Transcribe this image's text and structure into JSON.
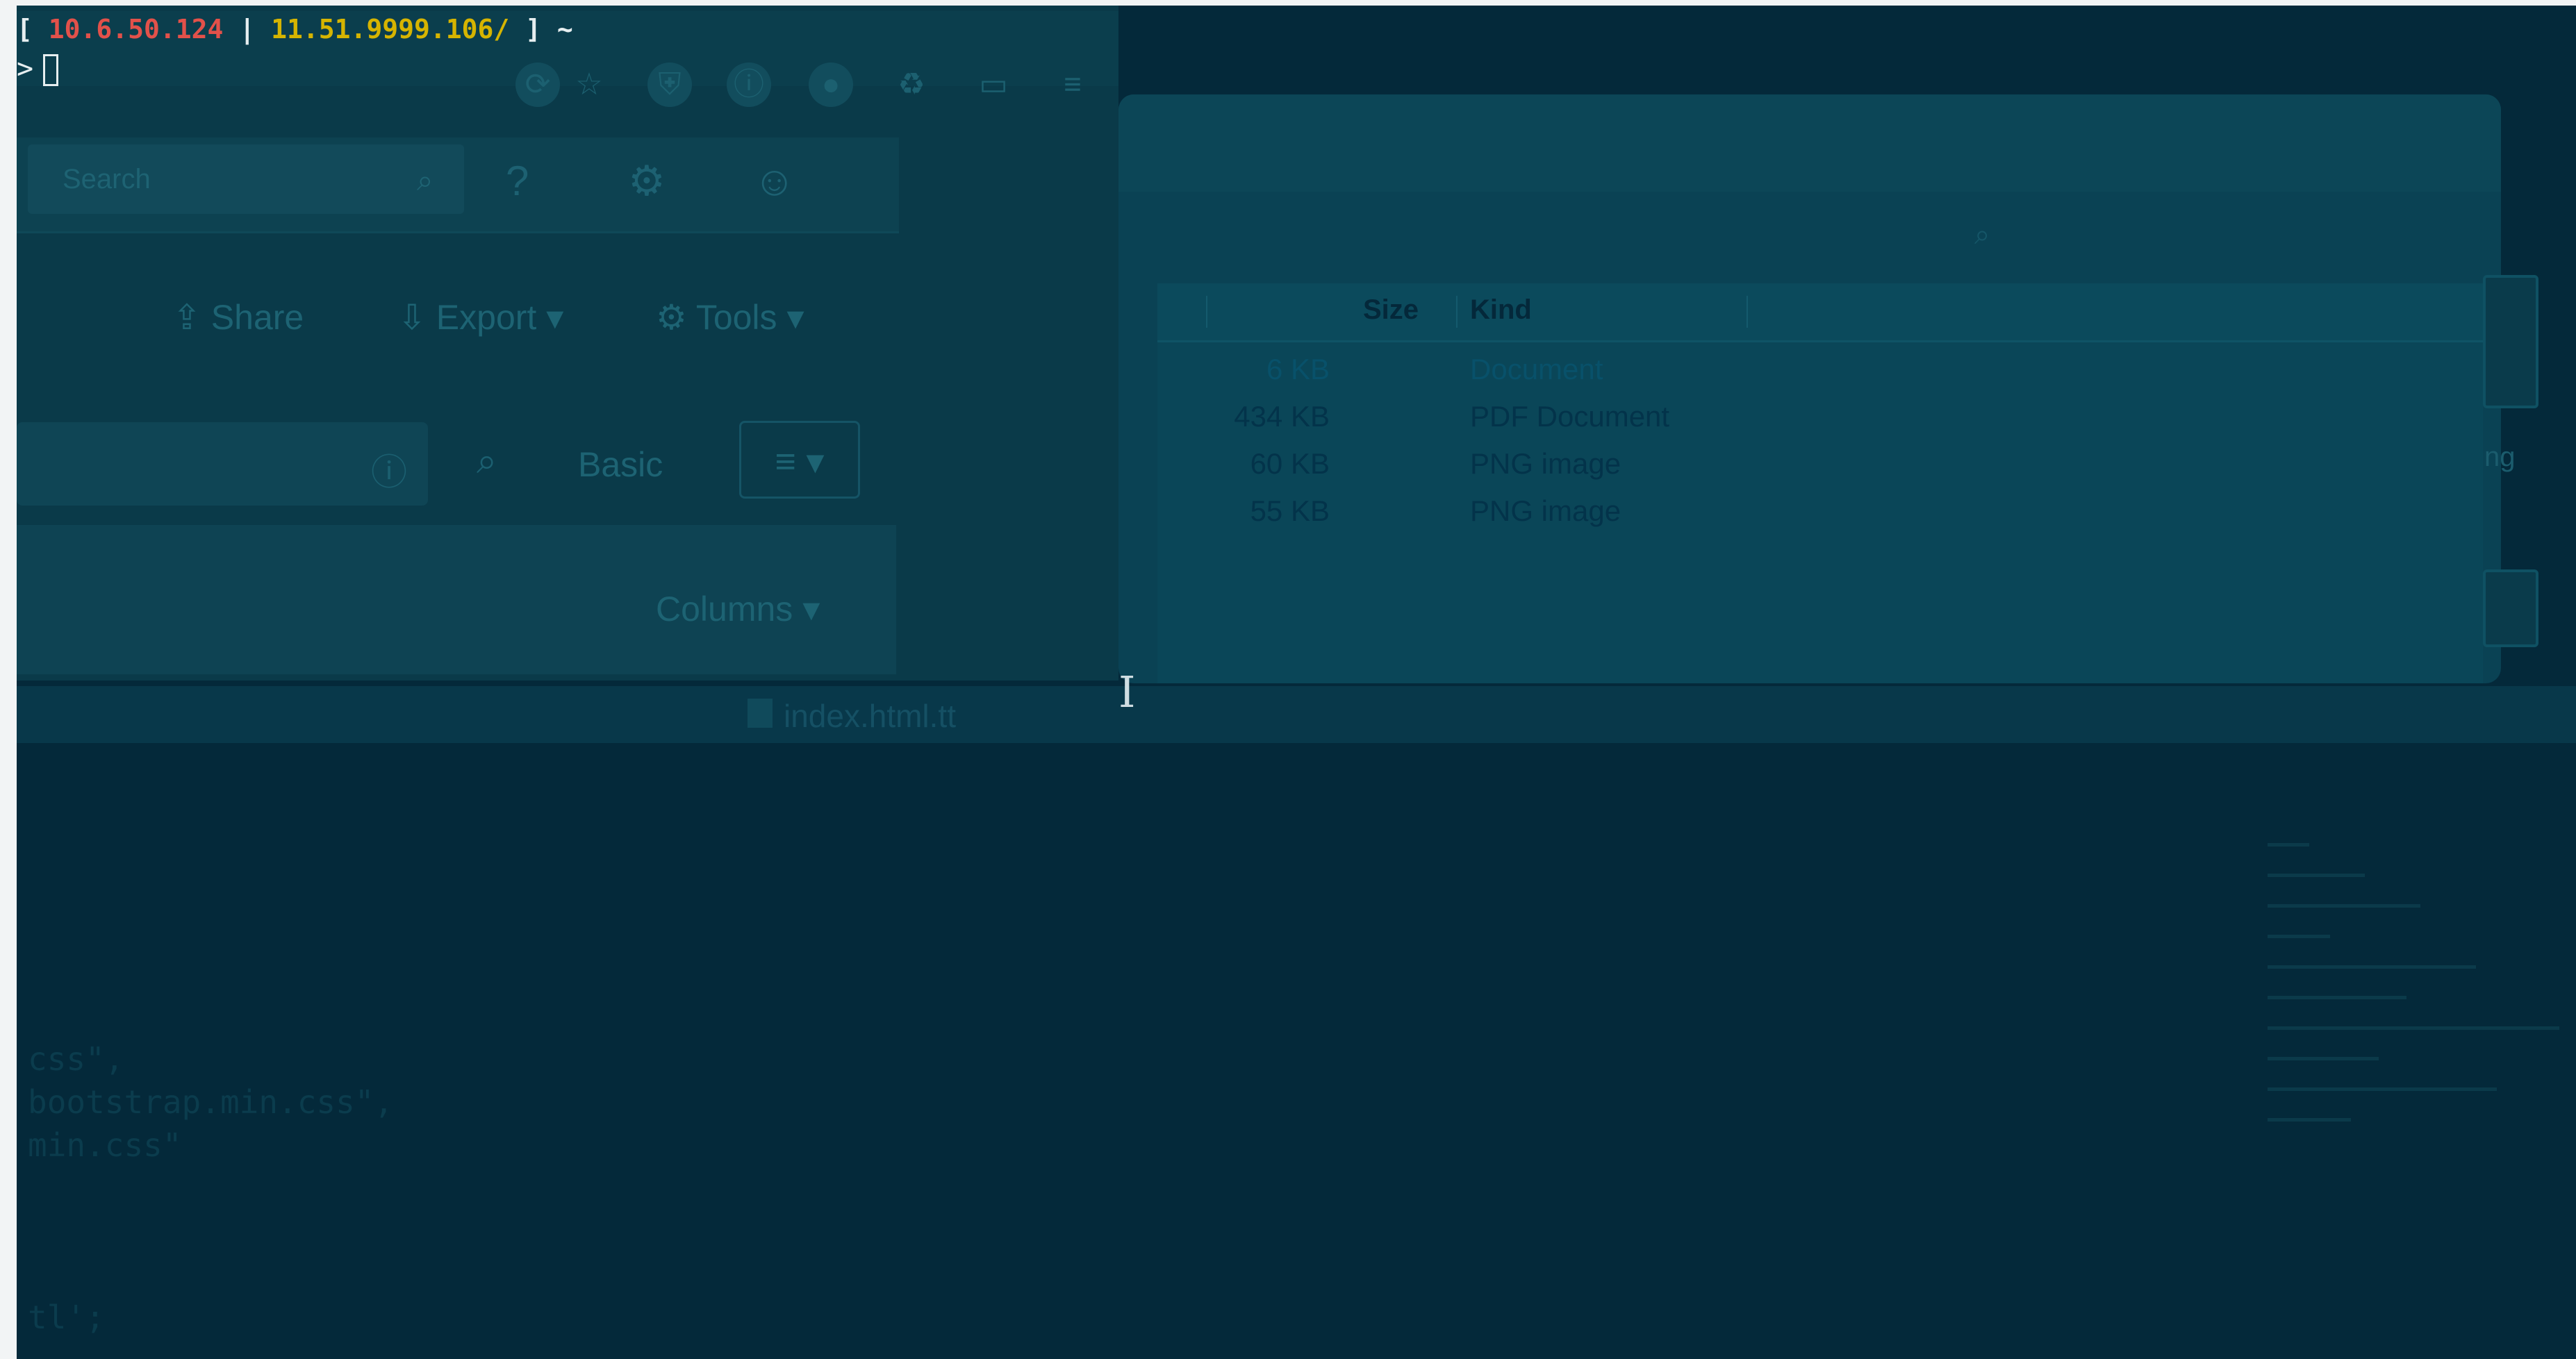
{
  "terminal": {
    "bracket_open": "[ ",
    "ip_local": "10.6.50.124",
    "separator": " | ",
    "ip_remote": "11.51.9999.106/",
    "bracket_close": " ] ~",
    "prompt": ">"
  },
  "browser": {
    "search_placeholder": "Search",
    "share_label": "Share",
    "export_label": "Export",
    "tools_label": "Tools",
    "basic_label": "Basic",
    "columns_label": "Columns"
  },
  "finder": {
    "columns": [
      "Size",
      "Kind"
    ],
    "files": [
      {
        "size": "6 KB",
        "kind": "Document"
      },
      {
        "size": "434 KB",
        "kind": "PDF Document"
      },
      {
        "size": "60 KB",
        "kind": "PNG image"
      },
      {
        "size": "55 KB",
        "kind": "PNG image"
      }
    ],
    "side_text": "ng"
  },
  "editor": {
    "tab_label": "index.html.tt",
    "code_lines": [
      "css\",",
      "bootstrap.min.css\",",
      "min.css\"",
      "tl';"
    ]
  },
  "colors": {
    "screen_bg": "#04293a",
    "ip_local": "#e2514a",
    "ip_remote": "#d6b400"
  }
}
